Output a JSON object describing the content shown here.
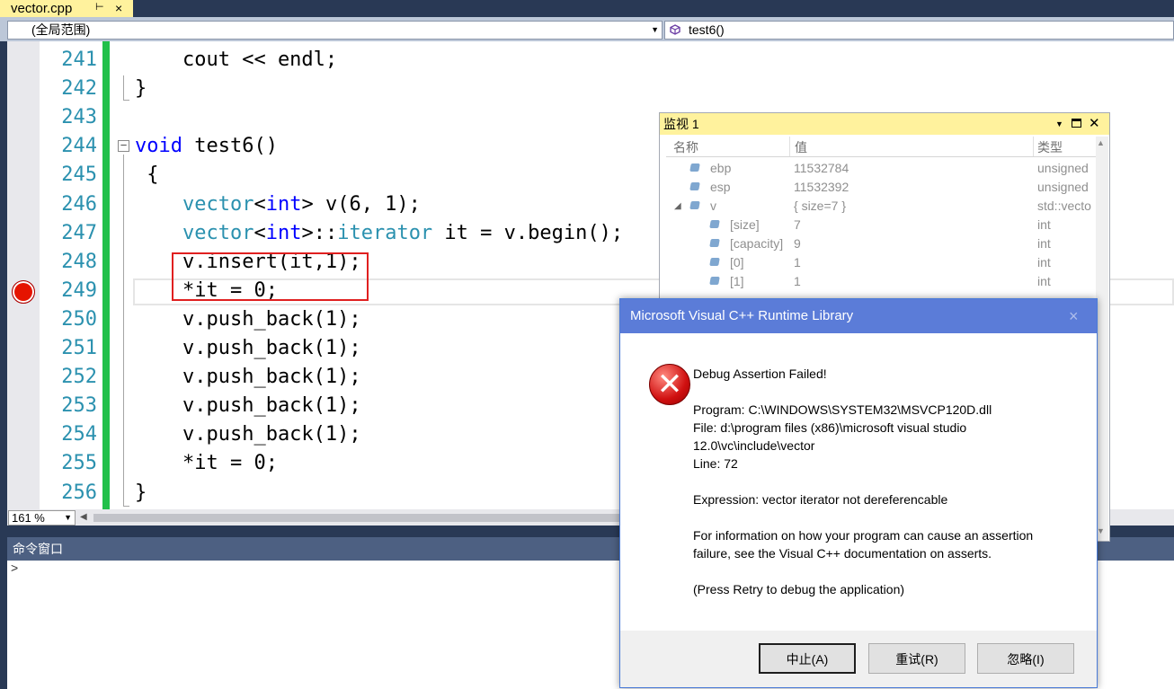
{
  "tab": {
    "filename": "vector.cpp",
    "pin": "⊢",
    "close": "×"
  },
  "nav": {
    "scope": "(全局范围)",
    "function": "test6()"
  },
  "code_lines": [
    {
      "num": "241",
      "parts": [
        [
          "",
          "    cout << endl;"
        ]
      ]
    },
    {
      "num": "242",
      "parts": [
        [
          "",
          "}"
        ]
      ]
    },
    {
      "num": "243",
      "parts": []
    },
    {
      "num": "244",
      "parts": [
        [
          "kw",
          "void"
        ],
        [
          "",
          " test6()"
        ]
      ]
    },
    {
      "num": "245",
      "parts": [
        [
          "",
          " {"
        ]
      ]
    },
    {
      "num": "246",
      "parts": [
        [
          "",
          "    "
        ],
        [
          "ty",
          "vector"
        ],
        [
          "",
          "<"
        ],
        [
          "kw",
          "int"
        ],
        [
          "",
          "> v(6, 1);"
        ]
      ]
    },
    {
      "num": "247",
      "parts": [
        [
          "",
          "    "
        ],
        [
          "ty",
          "vector"
        ],
        [
          "",
          "<"
        ],
        [
          "kw",
          "int"
        ],
        [
          "",
          ">::"
        ],
        [
          "ty",
          "iterator"
        ],
        [
          "",
          " it = v.begin();"
        ]
      ]
    },
    {
      "num": "248",
      "parts": [
        [
          "",
          "    v.insert(it,1);"
        ]
      ]
    },
    {
      "num": "249",
      "parts": [
        [
          "",
          "    *it = 0;"
        ]
      ]
    },
    {
      "num": "250",
      "parts": [
        [
          "",
          "    v.push_back(1);"
        ]
      ]
    },
    {
      "num": "251",
      "parts": [
        [
          "",
          "    v.push_back(1);"
        ]
      ]
    },
    {
      "num": "252",
      "parts": [
        [
          "",
          "    v.push_back(1);"
        ]
      ]
    },
    {
      "num": "253",
      "parts": [
        [
          "",
          "    v.push_back(1);"
        ]
      ]
    },
    {
      "num": "254",
      "parts": [
        [
          "",
          "    v.push_back(1);"
        ]
      ]
    },
    {
      "num": "255",
      "parts": [
        [
          "",
          "    *it = 0;"
        ]
      ]
    },
    {
      "num": "256",
      "parts": [
        [
          "",
          "}"
        ]
      ]
    }
  ],
  "zoom": "161 %",
  "command_window": {
    "title": "命令窗口",
    "prompt": ">"
  },
  "watch": {
    "title": "监视 1",
    "columns": [
      "名称",
      "值",
      "类型"
    ],
    "rows": [
      {
        "name": "ebp",
        "value": "11532784",
        "type": "unsigned",
        "indent": 0,
        "expand": ""
      },
      {
        "name": "esp",
        "value": "11532392",
        "type": "unsigned",
        "indent": 0,
        "expand": ""
      },
      {
        "name": "v",
        "value": "{ size=7 }",
        "type": "std::vecto",
        "indent": 0,
        "expand": "◢"
      },
      {
        "name": "[size]",
        "value": "7",
        "type": "int",
        "indent": 1,
        "expand": ""
      },
      {
        "name": "[capacity]",
        "value": "9",
        "type": "int",
        "indent": 1,
        "expand": ""
      },
      {
        "name": "[0]",
        "value": "1",
        "type": "int",
        "indent": 1,
        "expand": ""
      },
      {
        "name": "[1]",
        "value": "1",
        "type": "int",
        "indent": 1,
        "expand": ""
      }
    ]
  },
  "dialog": {
    "title": "Microsoft Visual C++ Runtime Library",
    "close": "×",
    "lines": [
      "Debug Assertion Failed!",
      "",
      "Program: C:\\WINDOWS\\SYSTEM32\\MSVCP120D.dll",
      "File: d:\\program files (x86)\\microsoft visual studio",
      "12.0\\vc\\include\\vector",
      "Line: 72",
      "",
      "Expression: vector iterator not dereferencable",
      "",
      "For information on how your program can cause an assertion",
      "failure, see the Visual C++ documentation on asserts.",
      "",
      "(Press Retry to debug the application)"
    ],
    "buttons": {
      "abort": "中止(A)",
      "retry": "重试(R)",
      "ignore": "忽略(I)"
    }
  },
  "colors": {
    "accent_blue": "#5B7CD8",
    "tab_yellow": "#FFF29D",
    "breakpoint": "#E51400"
  }
}
